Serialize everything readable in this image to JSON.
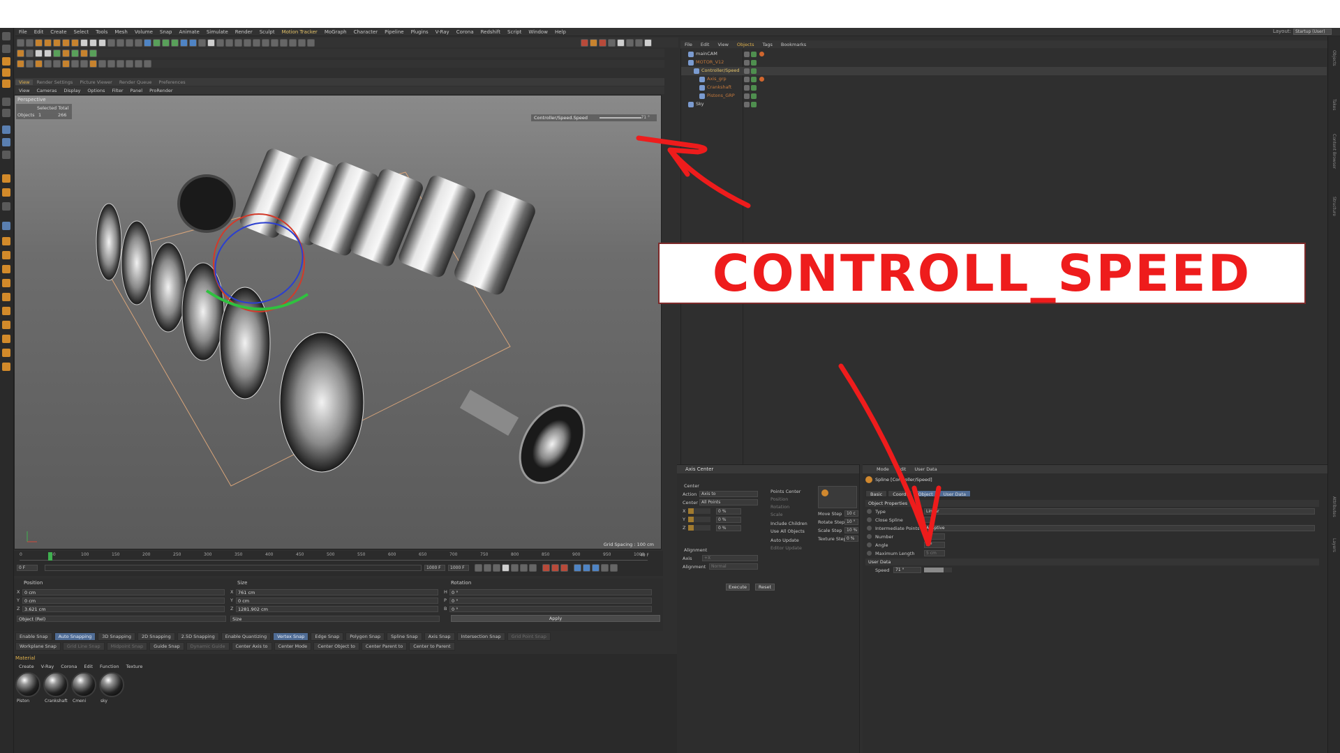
{
  "menu": [
    "File",
    "Edit",
    "Create",
    "Select",
    "Tools",
    "Mesh",
    "Volume",
    "Snap",
    "Animate",
    "Simulate",
    "Render",
    "Sculpt",
    "Motion Tracker",
    "MoGraph",
    "Character",
    "Pipeline",
    "Plugins",
    "V-Ray",
    "Corona",
    "Redshift",
    "Script",
    "Window",
    "Help"
  ],
  "layout": {
    "label": "Layout:",
    "value": "Startup (User)"
  },
  "render_tabs": [
    "View",
    "Render Settings",
    "Picture Viewer",
    "Render Queue",
    "Preferences"
  ],
  "view_menu": [
    "View",
    "Cameras",
    "Display",
    "Options",
    "Filter",
    "Panel",
    "ProRender"
  ],
  "viewport": {
    "projection": "Perspective",
    "hud": {
      "selected_total": "Selected Total",
      "objects_label": "Objects",
      "objects_selected": "1",
      "objects_total": "266"
    },
    "speed_hud": {
      "label": "Controller/Speed.Speed",
      "value": "71 °"
    },
    "grid_spacing": "Grid Spacing : 100 cm"
  },
  "timeline": {
    "ticks": [
      "0",
      "50",
      "100",
      "150",
      "200",
      "250",
      "300",
      "350",
      "400",
      "450",
      "500",
      "550",
      "600",
      "650",
      "700",
      "750",
      "800",
      "850",
      "900",
      "950",
      "1000"
    ],
    "start": "0 F",
    "current": "49 F",
    "end": "1000 F",
    "end2": "1000 F"
  },
  "coordinates": {
    "headers": {
      "position": "Position",
      "size": "Size",
      "rotation": "Rotation"
    },
    "position": [
      {
        "axis": "X",
        "value": "0 cm"
      },
      {
        "axis": "Y",
        "value": "0 cm"
      },
      {
        "axis": "Z",
        "value": "3.621 cm"
      }
    ],
    "size": [
      {
        "axis": "X",
        "value": "761 cm"
      },
      {
        "axis": "Y",
        "value": "0 cm"
      },
      {
        "axis": "Z",
        "value": "1281.902 cm"
      }
    ],
    "rotation": [
      {
        "axis": "H",
        "value": "0 °"
      },
      {
        "axis": "P",
        "value": "0 °"
      },
      {
        "axis": "B",
        "value": "0 °"
      }
    ],
    "mode": "Object (Rel)",
    "size_mode": "Size",
    "apply": "Apply"
  },
  "snap_row1": [
    "Enable Snap",
    "Auto Snapping",
    "3D Snapping",
    "2D Snapping",
    "2.5D Snapping",
    "Enable Quantizing",
    "Vertex Snap",
    "Edge Snap",
    "Polygon Snap",
    "Spline Snap",
    "Axis Snap",
    "Intersection Snap",
    "Grid Point Snap"
  ],
  "snap_row2": [
    "Workplane Snap",
    "Grid Line Snap",
    "Midpoint Snap",
    "Guide Snap",
    "Dynamic Guide",
    "Center Axis to",
    "Center Mode",
    "Center Object to",
    "Center Parent to",
    "Center to Parent"
  ],
  "materials": {
    "title": "Material",
    "menu": [
      "Create",
      "V-Ray",
      "Corona",
      "Edit",
      "Function",
      "Texture"
    ],
    "items": [
      "Piston",
      "Crankshaft",
      "Cmeni",
      "sky"
    ]
  },
  "object_manager": {
    "menu": [
      "File",
      "Edit",
      "View",
      "Objects",
      "Tags",
      "Bookmarks"
    ],
    "objects": [
      {
        "name": "mainCAM",
        "color": "#cfcfcf"
      },
      {
        "name": "MOTOR_V12",
        "color": "#c77a3c"
      },
      {
        "name": "Controller/Speed",
        "color": "#e7c56a"
      },
      {
        "name": "Axis_grp",
        "color": "#c77a3c"
      },
      {
        "name": "Crankshaft",
        "color": "#c77a3c"
      },
      {
        "name": "Pistons_GRP",
        "color": "#c77a3c"
      },
      {
        "name": "Sky",
        "color": "#cfcfcf"
      }
    ]
  },
  "axis_center": {
    "title": "Axis Center",
    "center_check": "Center",
    "action_label": "Action",
    "action_value": "Axis to",
    "center_label": "Center",
    "center_value": "All Points",
    "sliders": [
      {
        "axis": "X",
        "value": "0 %",
        "fill": 0.25
      },
      {
        "axis": "Y",
        "value": "0 %",
        "fill": 0.25
      },
      {
        "axis": "Z",
        "value": "0 %",
        "fill": 0.25
      }
    ],
    "options": [
      "Points Center",
      "Position",
      "Rotation",
      "Scale",
      "Include Children",
      "Use All Objects",
      "Auto Update",
      "Editor Update"
    ],
    "alignment": "Alignment",
    "axis_label": "Axis",
    "axis_value": "+X",
    "alignment_label": "Alignment",
    "alignment_value": "Normal",
    "steps": [
      {
        "label": "Move Step",
        "value": "10 c"
      },
      {
        "label": "Rotate Step",
        "value": "10 °"
      },
      {
        "label": "Scale Step",
        "value": "10 %"
      },
      {
        "label": "Texture Step",
        "value": "0 %"
      }
    ],
    "execute": "Execute",
    "reset": "Reset"
  },
  "attributes": {
    "menu": [
      "Mode",
      "Edit",
      "User Data"
    ],
    "object_title": "Spline [Controller/Speed]",
    "tabs": [
      "Basic",
      "Coord.",
      "Object",
      "User Data"
    ],
    "section": "Object Properties",
    "rows": [
      {
        "label": "Type",
        "value": "Linear"
      },
      {
        "label": "Close Spline",
        "value": ""
      },
      {
        "label": "Intermediate Points",
        "value": "Adaptive"
      },
      {
        "label": "Number",
        "value": "8"
      },
      {
        "label": "Angle",
        "value": "5 °"
      },
      {
        "label": "Maximum Length",
        "value": "5 cm"
      }
    ],
    "user_data": "User Data",
    "speed_label": "Speed",
    "speed_value": "71 °",
    "speed_fill": 0.71
  },
  "annotation": {
    "text": "CONTROLL_SPEED",
    "color": "#ee1c1c"
  }
}
